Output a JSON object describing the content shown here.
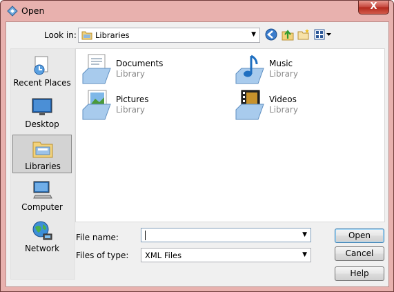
{
  "window": {
    "title": "Open",
    "close_symbol": "X"
  },
  "toolbar": {
    "lookin_label": "Look in:",
    "lookin_value": "Libraries",
    "dropdown_arrow": "▼"
  },
  "places": [
    {
      "label": "Recent Places"
    },
    {
      "label": "Desktop"
    },
    {
      "label": "Libraries"
    },
    {
      "label": "Computer"
    },
    {
      "label": "Network"
    }
  ],
  "libraries": [
    {
      "name": "Documents",
      "type": "Library"
    },
    {
      "name": "Music",
      "type": "Library"
    },
    {
      "name": "Pictures",
      "type": "Library"
    },
    {
      "name": "Videos",
      "type": "Library"
    }
  ],
  "form": {
    "file_name_label": "File name:",
    "file_name_value": "",
    "file_type_label": "Files of type:",
    "file_type_value": "XML Files"
  },
  "buttons": {
    "open": "Open",
    "cancel": "Cancel",
    "help": "Help"
  }
}
